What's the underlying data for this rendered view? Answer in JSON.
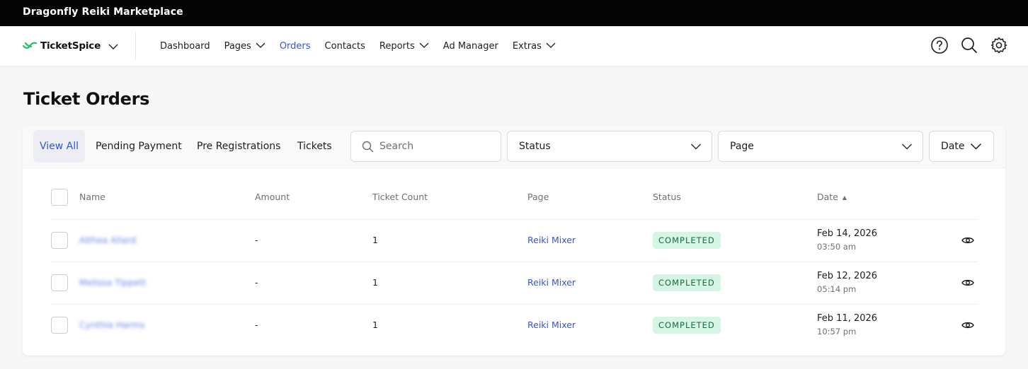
{
  "app": {
    "title": "Dragonfly Reiki Marketplace"
  },
  "nav": {
    "brand": "TicketSpice",
    "items": [
      {
        "label": "Dashboard",
        "dropdown": false,
        "active": false
      },
      {
        "label": "Pages",
        "dropdown": true,
        "active": false
      },
      {
        "label": "Orders",
        "dropdown": false,
        "active": true
      },
      {
        "label": "Contacts",
        "dropdown": false,
        "active": false
      },
      {
        "label": "Reports",
        "dropdown": true,
        "active": false
      },
      {
        "label": "Ad Manager",
        "dropdown": false,
        "active": false
      },
      {
        "label": "Extras",
        "dropdown": true,
        "active": false
      }
    ],
    "icons": [
      "help-icon",
      "search-icon",
      "gear-icon"
    ]
  },
  "page": {
    "title": "Ticket Orders"
  },
  "filters": {
    "tabs": [
      "View All",
      "Pending Payment",
      "Pre Registrations",
      "Tickets"
    ],
    "active_tab": "View All",
    "search_placeholder": "Search",
    "status_label": "Status",
    "page_label": "Page",
    "date_label": "Date"
  },
  "table": {
    "headers": {
      "name": "Name",
      "amount": "Amount",
      "ticket_count": "Ticket Count",
      "page": "Page",
      "status": "Status",
      "date": "Date",
      "date_sort_indicator": "▲"
    },
    "rows": [
      {
        "name": "Althea Allard",
        "amount": "-",
        "ticket_count": "1",
        "page": "Reiki Mixer",
        "status": "COMPLETED",
        "date": "Feb 14, 2026",
        "time": "03:50 am"
      },
      {
        "name": "Melissa Tippett",
        "amount": "-",
        "ticket_count": "1",
        "page": "Reiki Mixer",
        "status": "COMPLETED",
        "date": "Feb 12, 2026",
        "time": "05:14 pm"
      },
      {
        "name": "Cynthia Harms",
        "amount": "-",
        "ticket_count": "1",
        "page": "Reiki Mixer",
        "status": "COMPLETED",
        "date": "Feb 11, 2026",
        "time": "10:57 pm"
      }
    ]
  },
  "colors": {
    "accent": "#3456d6",
    "status_completed_bg": "#d6f5e4",
    "status_completed_text": "#136b45",
    "brand_green": "#1fbf6b"
  }
}
